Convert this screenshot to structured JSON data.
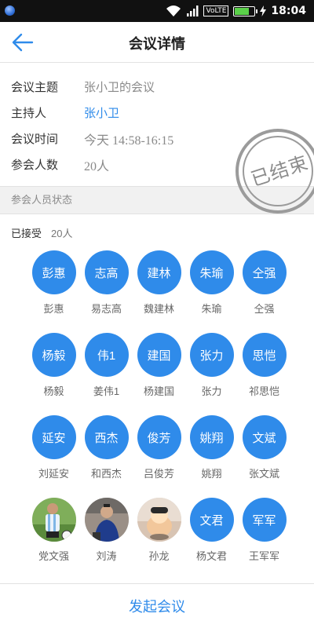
{
  "status_bar": {
    "volte": "VoLTE",
    "battery_level": 0.75,
    "time": "18:04",
    "icons": [
      "app-dot-icon",
      "wifi-icon",
      "signal-icon",
      "volte-icon",
      "battery-icon",
      "charging-icon"
    ]
  },
  "header": {
    "title": "会议详情",
    "back_icon": "arrow-left-icon"
  },
  "meeting": {
    "topic_label": "会议主题",
    "topic": "张小卫的会议",
    "host_label": "主持人",
    "host": "张小卫",
    "time_label": "会议时间",
    "time": "今天 14:58-16:15",
    "count_label": "参会人数",
    "count": "20人",
    "stamp": "已结束"
  },
  "attendees": {
    "section_title": "参会人员状态",
    "accepted_label": "已接受",
    "accepted_count": "20人",
    "members": [
      {
        "avatar": "彭惠",
        "name": "彭惠"
      },
      {
        "avatar": "志高",
        "name": "易志高"
      },
      {
        "avatar": "建林",
        "name": "魏建林"
      },
      {
        "avatar": "朱瑜",
        "name": "朱瑜"
      },
      {
        "avatar": "仝强",
        "name": "仝强"
      },
      {
        "avatar": "杨毅",
        "name": "杨毅"
      },
      {
        "avatar": "伟1",
        "name": "姜伟1"
      },
      {
        "avatar": "建国",
        "name": "杨建国"
      },
      {
        "avatar": "张力",
        "name": "张力"
      },
      {
        "avatar": "思恺",
        "name": "祁思恺"
      },
      {
        "avatar": "延安",
        "name": "刘延安"
      },
      {
        "avatar": "西杰",
        "name": "和西杰"
      },
      {
        "avatar": "俊芳",
        "name": "吕俊芳"
      },
      {
        "avatar": "姚翔",
        "name": "姚翔"
      },
      {
        "avatar": "文斌",
        "name": "张文斌"
      },
      {
        "avatar": "",
        "name": "党文强",
        "photo": "soccer-player-photo"
      },
      {
        "avatar": "",
        "name": "刘涛",
        "photo": "person-photo"
      },
      {
        "avatar": "",
        "name": "孙龙",
        "photo": "cartoon-character-photo"
      },
      {
        "avatar": "文君",
        "name": "杨文君"
      },
      {
        "avatar": "军军",
        "name": "王军军"
      }
    ]
  },
  "footer": {
    "start_meeting": "发起会议"
  },
  "colors": {
    "accent": "#2f8bea",
    "status_bar": "#111111",
    "section_bg": "#f1f1f1",
    "stamp": "#9b9b9b"
  }
}
